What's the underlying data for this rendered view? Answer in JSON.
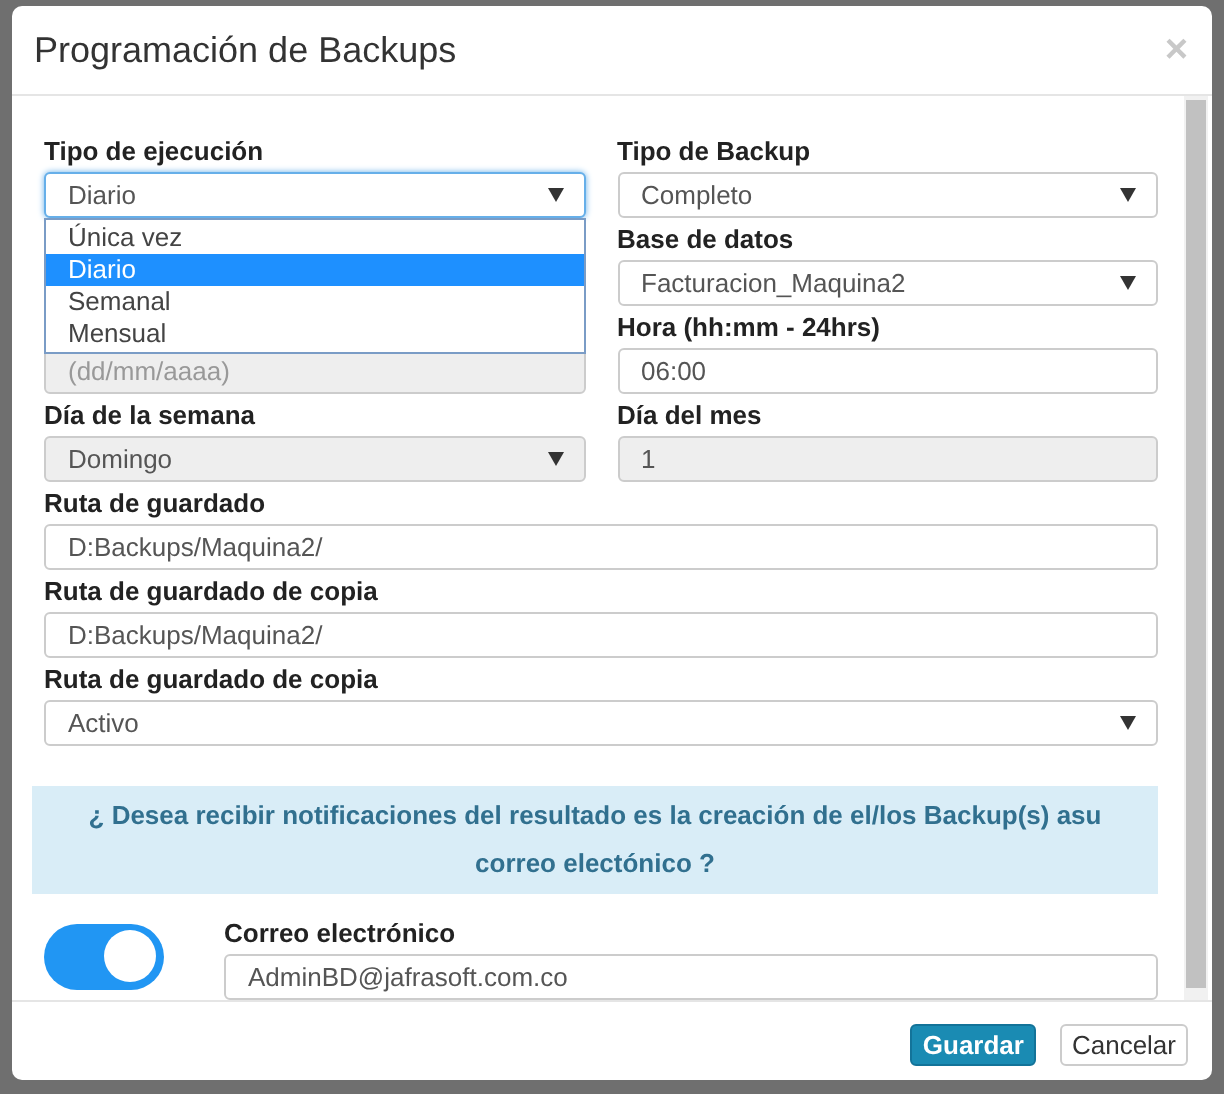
{
  "dialog": {
    "title": "Programación de Backups",
    "close": "×"
  },
  "execution_type": {
    "label": "Tipo de ejecución",
    "value": "Diario",
    "expanded": true,
    "options": [
      {
        "label": "Única vez",
        "selected": false
      },
      {
        "label": "Diario",
        "selected": true
      },
      {
        "label": "Semanal",
        "selected": false
      },
      {
        "label": "Mensual",
        "selected": false
      }
    ]
  },
  "date": {
    "placeholder": "(dd/mm/aaaa)",
    "disabled": true
  },
  "backup_type": {
    "label": "Tipo de Backup",
    "value": "Completo"
  },
  "database": {
    "label": "Base de datos",
    "value": "Facturacion_Maquina2"
  },
  "time": {
    "label": "Hora (hh:mm - 24hrs)",
    "value": "06:00"
  },
  "weekday": {
    "label": "Día de la semana",
    "value": "Domingo",
    "disabled": true
  },
  "month_day": {
    "label": "Día del mes",
    "value": "1",
    "disabled": true
  },
  "rows": [
    {
      "kind": "text",
      "label": "Ruta de guardado",
      "value": "D:Backups/Maquina2/"
    },
    {
      "kind": "text",
      "label": "Ruta de guardado de copia",
      "value": "D:Backups/Maquina2/"
    },
    {
      "kind": "select",
      "label": "Ruta de guardado de copia",
      "value": "Activo"
    }
  ],
  "notice": "¿ Desea recibir notificaciones del resultado es la creación de el/los Backup(s) asu correo electónico ?",
  "notifications": {
    "on": true,
    "label": "Correo electrónico",
    "value": "AdminBD@jafrasoft.com.co"
  },
  "buttons": [
    {
      "label": "Guardar",
      "kind": "primary"
    },
    {
      "label": "Cancelar",
      "kind": "default"
    }
  ]
}
